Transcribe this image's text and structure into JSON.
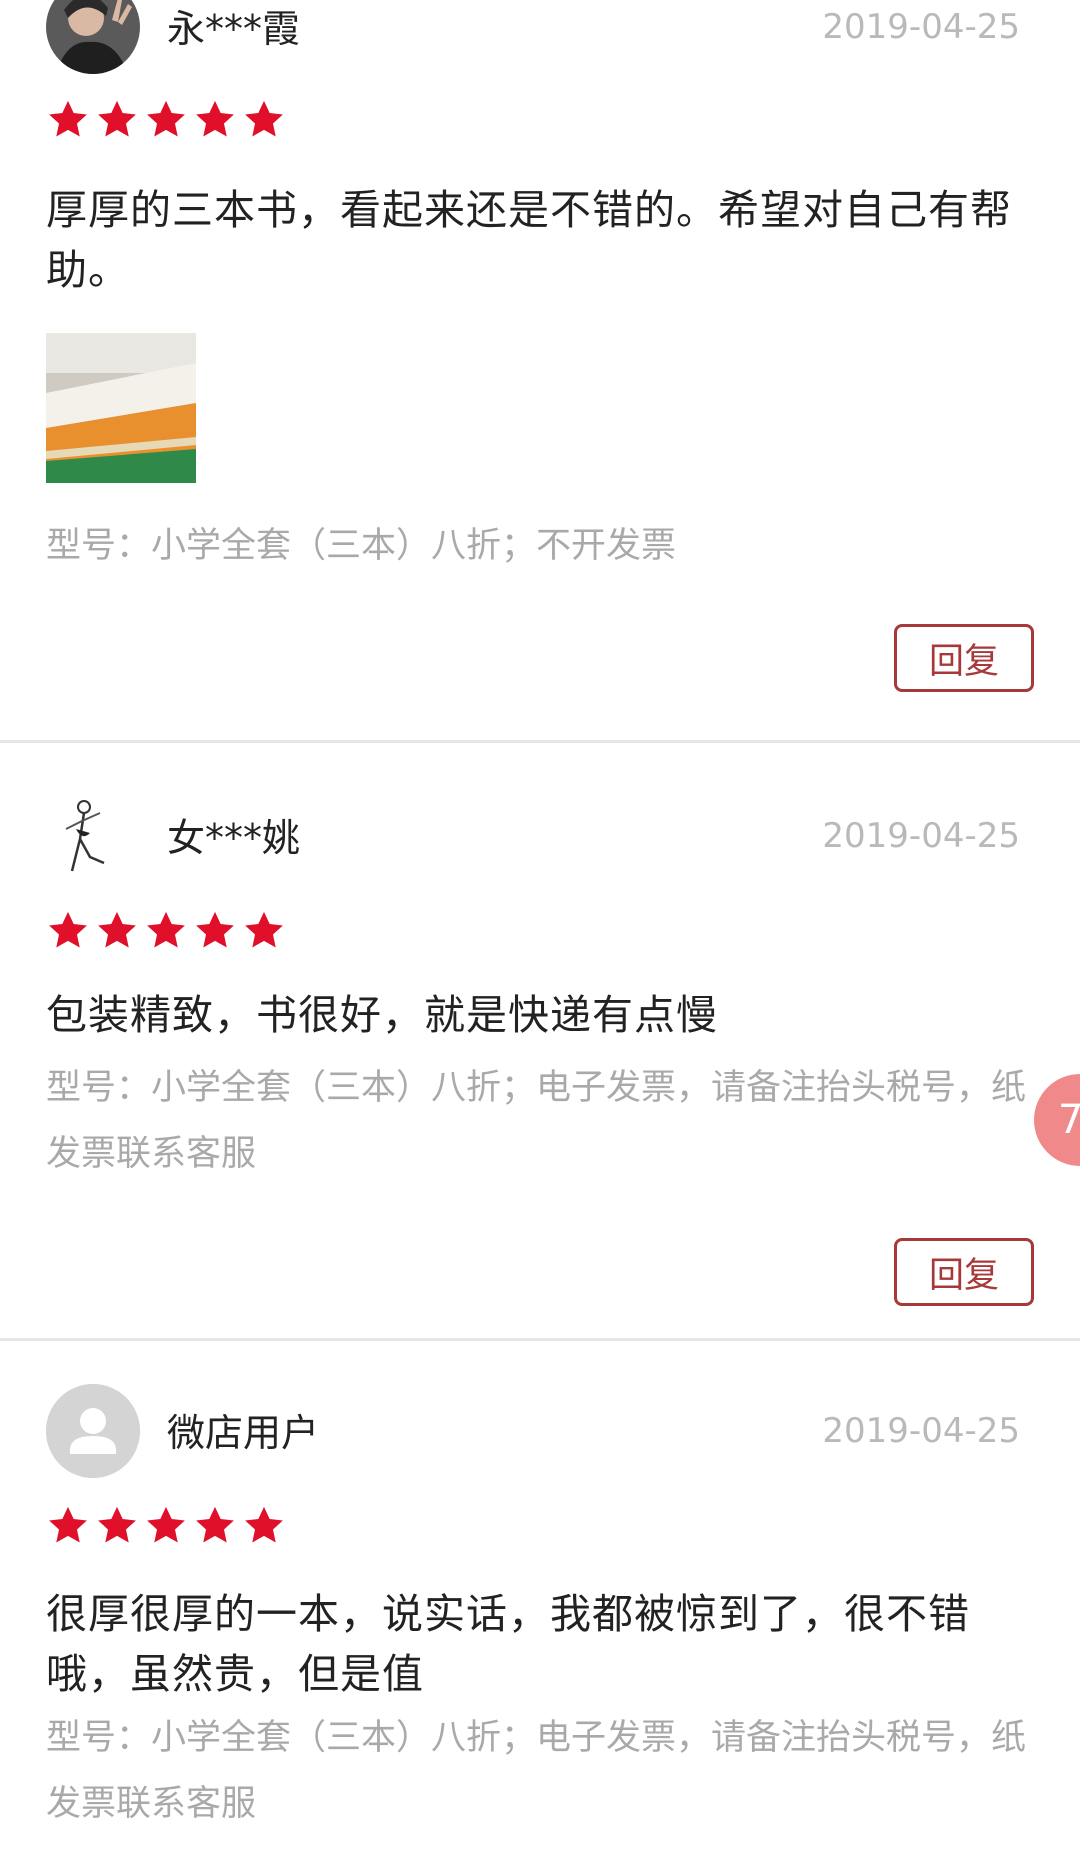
{
  "reviews": [
    {
      "username": "永***霞",
      "date": "2019-04-25",
      "rating": 5,
      "content": "厚厚的三本书，看起来还是不错的。希望对自己有帮助。",
      "variant": "型号：小学全套（三本）八折；不开发票",
      "reply_label": "回复",
      "avatar_icon": "user-photo-avatar",
      "has_photo": true
    },
    {
      "username": "女***姚",
      "date": "2019-04-25",
      "rating": 5,
      "content": "包装精致，书很好，就是快递有点慢",
      "variant": "型号：小学全套（三本）八折；电子发票，请备注抬头税号，纸发票联系客服",
      "reply_label": "回复",
      "avatar_icon": "dancer-sketch-avatar"
    },
    {
      "username": "微店用户",
      "date": "2019-04-25",
      "rating": 5,
      "content": "很厚很厚的一本，说实话，我都被惊到了，很不错哦，虽然贵，但是值",
      "variant": "型号：小学全套（三本）八折；电子发票，请备注抬头税号，纸发票联系客服",
      "avatar_icon": "default-user-avatar"
    }
  ],
  "floating_badge": {
    "text": "7"
  },
  "colors": {
    "star": "#e0102a",
    "reply_border": "#a8393a",
    "meta_text": "#a9a9a9",
    "date_text": "#b9b9b9",
    "badge": "#f08a8a"
  }
}
